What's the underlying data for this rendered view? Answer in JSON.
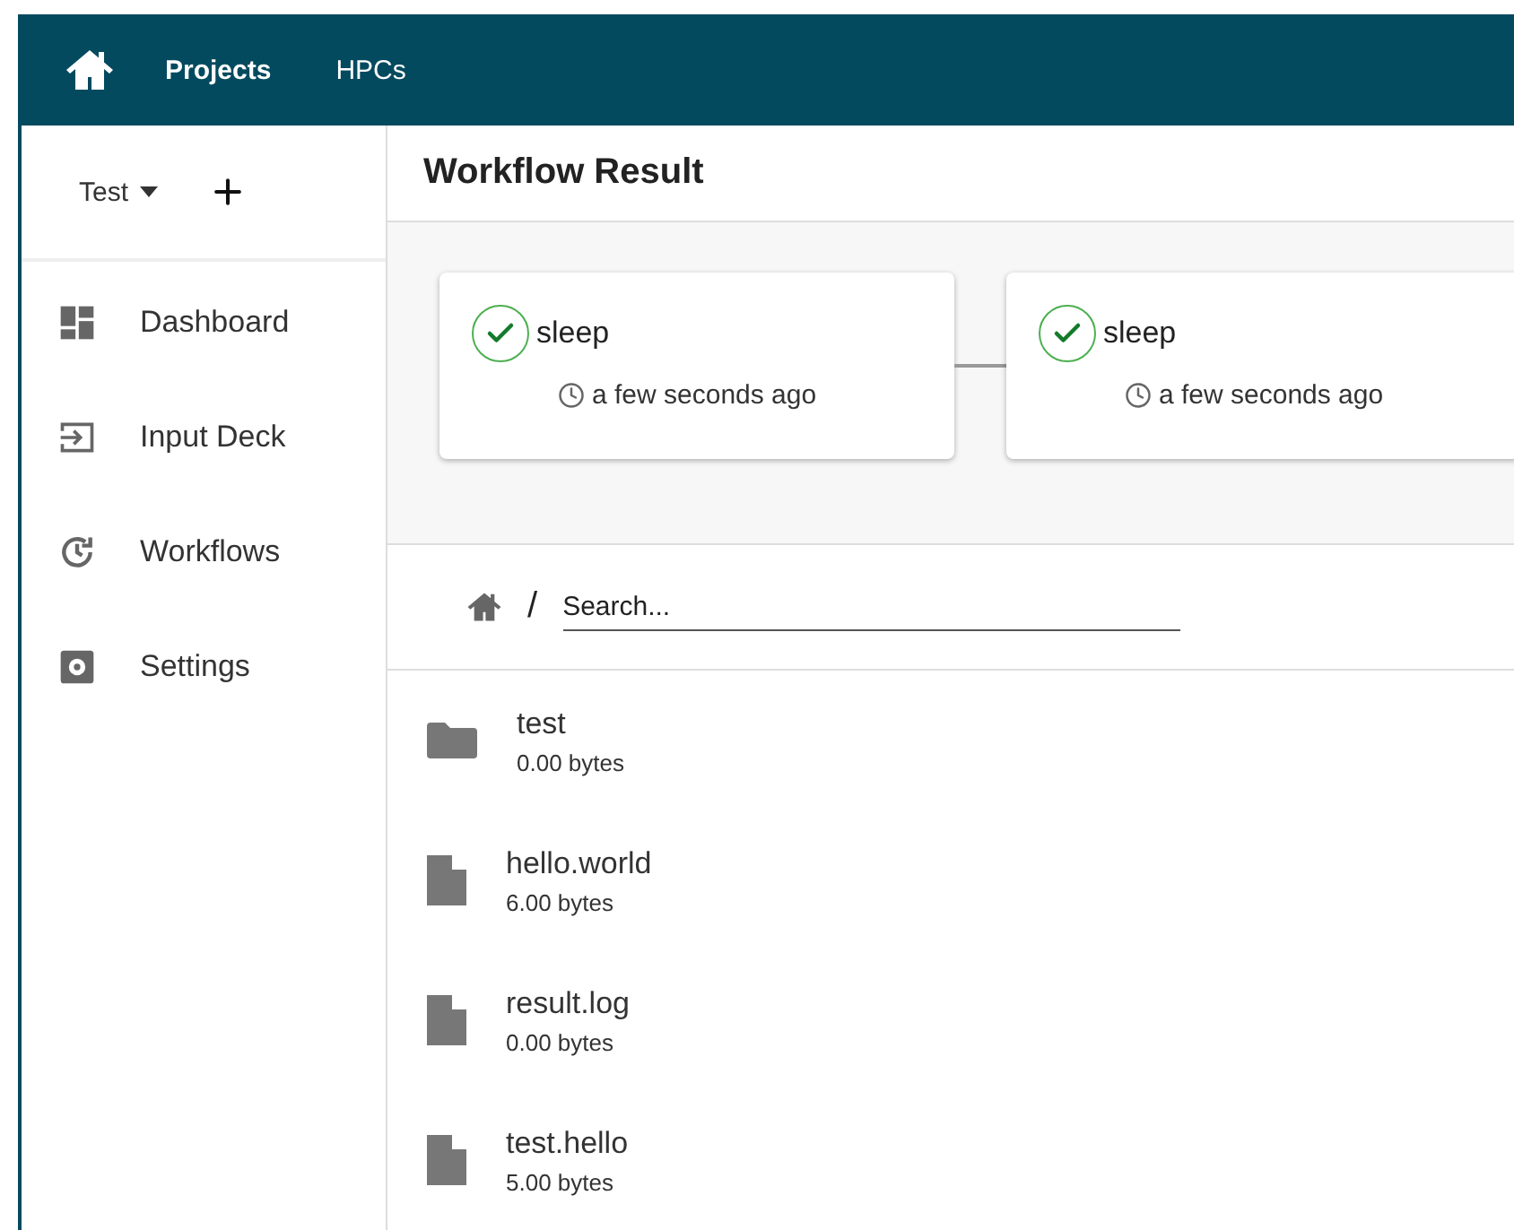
{
  "topbar": {
    "nav": [
      {
        "label": "Projects",
        "selected": true
      },
      {
        "label": "HPCs",
        "selected": false
      }
    ]
  },
  "sidebar": {
    "project": "Test",
    "items": [
      {
        "label": "Dashboard",
        "kind": "dashboard"
      },
      {
        "label": "Input Deck",
        "kind": "input"
      },
      {
        "label": "Workflows",
        "kind": "workflows"
      },
      {
        "label": "Settings",
        "kind": "settings"
      }
    ]
  },
  "header": {
    "title": "Workflow Result"
  },
  "workflow": {
    "jobs": [
      {
        "name": "sleep",
        "time": "a few seconds ago",
        "succeeded": true
      },
      {
        "name": "sleep",
        "time": "a few seconds ago",
        "succeeded": true
      }
    ]
  },
  "browser": {
    "separator": "/",
    "search": {
      "placeholder": "Search..."
    },
    "files": [
      {
        "name": "test",
        "size": "0.00 bytes",
        "kind": "folder"
      },
      {
        "name": "hello.world",
        "size": "6.00 bytes",
        "kind": "file"
      },
      {
        "name": "result.log",
        "size": "0.00 bytes",
        "kind": "file"
      },
      {
        "name": "test.hello",
        "size": "5.00 bytes",
        "kind": "file"
      }
    ]
  }
}
